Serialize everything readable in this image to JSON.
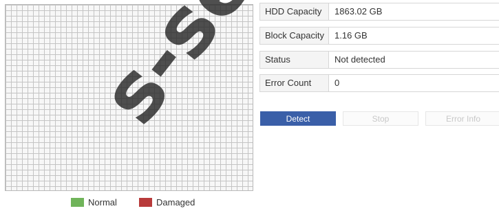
{
  "info": {
    "hdd_capacity": {
      "label": "HDD Capacity",
      "value": "1863.02 GB"
    },
    "block_capacity": {
      "label": "Block Capacity",
      "value": "1.16 GB"
    },
    "status": {
      "label": "Status",
      "value": "Not detected"
    },
    "error_count": {
      "label": "Error Count",
      "value": "0"
    }
  },
  "buttons": {
    "detect": "Detect",
    "stop": "Stop",
    "error_info": "Error Info"
  },
  "legend": {
    "normal": {
      "label": "Normal",
      "color": "#70b45a"
    },
    "damaged": {
      "label": "Damaged",
      "color": "#b83a3a"
    }
  },
  "colors": {
    "detect_button": "#3a5fa8",
    "grid_line": "#c4c4c4"
  },
  "watermark": "s-securi"
}
